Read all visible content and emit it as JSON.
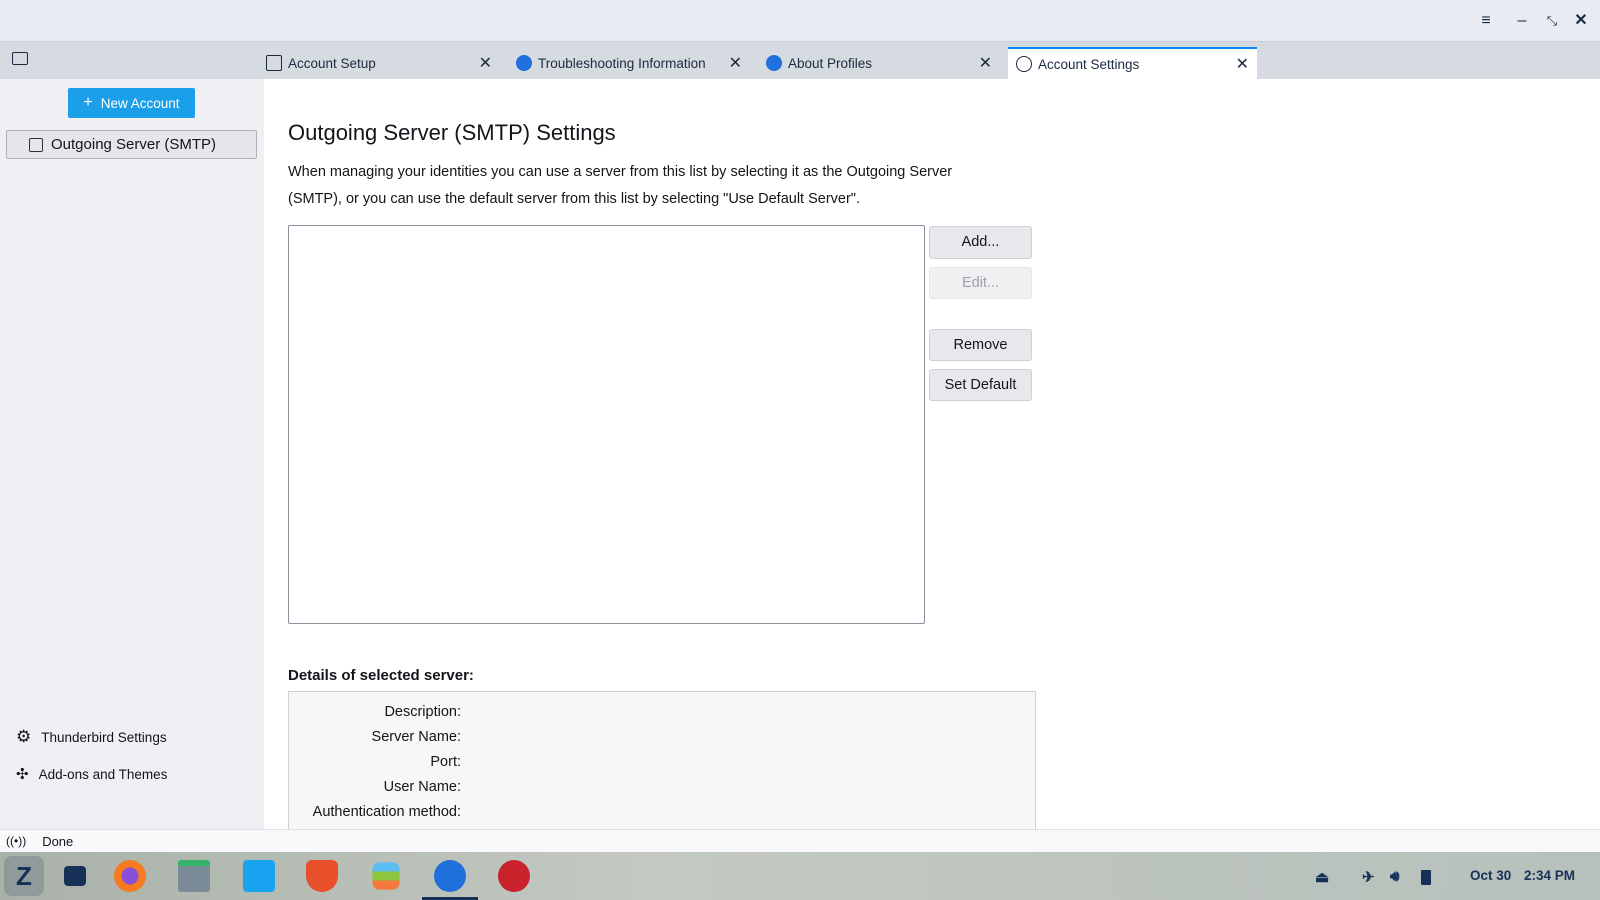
{
  "window": {
    "controls": [
      "menu",
      "minimize",
      "restore",
      "close"
    ]
  },
  "tabs": [
    {
      "label": "Account Setup",
      "icon": "account-setup-icon"
    },
    {
      "label": "Troubleshooting Information",
      "icon": "thunderbird-icon"
    },
    {
      "label": "About Profiles",
      "icon": "thunderbird-icon"
    },
    {
      "label": "Account Settings",
      "icon": "settings-icon",
      "active": true
    }
  ],
  "sidebar": {
    "new_account": "New Account",
    "items": [
      {
        "label": "Outgoing Server (SMTP)"
      }
    ],
    "footer": [
      {
        "label": "Thunderbird Settings"
      },
      {
        "label": "Add-ons and Themes"
      }
    ]
  },
  "main": {
    "title": "Outgoing Server (SMTP) Settings",
    "description": "When managing your identities you can use a server from this list by selecting it as the Outgoing Server (SMTP), or you can use the default server from this list by selecting \"Use Default Server\".",
    "buttons": {
      "add": "Add...",
      "edit": "Edit...",
      "remove": "Remove",
      "set_default": "Set Default"
    },
    "details_heading": "Details of selected server:",
    "details": {
      "description": "Description:",
      "server_name": "Server Name:",
      "port": "Port:",
      "user_name": "User Name:",
      "auth": "Authentication method:"
    }
  },
  "status": {
    "text": "Done"
  },
  "taskbar": {
    "date": "Oct 30",
    "time": "2:34 PM"
  },
  "colors": {
    "accent": "#0a84ff",
    "new_account": "#1a9fe8"
  }
}
